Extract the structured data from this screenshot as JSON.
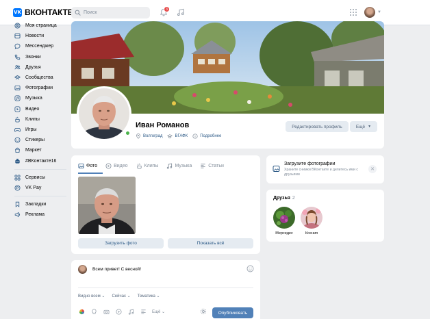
{
  "header": {
    "logo_mark": "VK",
    "logo_text": "ВКОНТАКТЕ",
    "search_placeholder": "Поиск",
    "notifications_count": "3"
  },
  "sidebar": {
    "items": [
      {
        "label": "Моя страница",
        "icon": "user-circle-icon"
      },
      {
        "label": "Новости",
        "icon": "news-icon"
      },
      {
        "label": "Мессенджер",
        "icon": "message-icon"
      },
      {
        "label": "Звонки",
        "icon": "phone-icon"
      },
      {
        "label": "Друзья",
        "icon": "friends-icon"
      },
      {
        "label": "Сообщества",
        "icon": "communities-icon"
      },
      {
        "label": "Фотографии",
        "icon": "photo-icon"
      },
      {
        "label": "Музыка",
        "icon": "music-icon"
      },
      {
        "label": "Видео",
        "icon": "video-icon"
      },
      {
        "label": "Клипы",
        "icon": "clips-icon"
      },
      {
        "label": "Игры",
        "icon": "gamepad-icon"
      },
      {
        "label": "Стикеры",
        "icon": "sticker-icon"
      },
      {
        "label": "Маркет",
        "icon": "market-icon"
      },
      {
        "label": "#ВКонтакте16",
        "icon": "cake-icon"
      }
    ],
    "items2": [
      {
        "label": "Сервисы",
        "icon": "services-icon"
      },
      {
        "label": "VK Pay",
        "icon": "vkpay-icon"
      }
    ],
    "items3": [
      {
        "label": "Закладки",
        "icon": "bookmark-icon"
      },
      {
        "label": "Реклама",
        "icon": "ads-icon"
      }
    ]
  },
  "profile": {
    "name": "Иван Романов",
    "city": "Волгоград",
    "university": "ВГАФК",
    "details": "Подробнее",
    "edit_button": "Редактировать профиль",
    "more_button": "Ещё",
    "online": true
  },
  "photos": {
    "tabs": [
      {
        "label": "Фото",
        "icon": "photo-icon",
        "active": true
      },
      {
        "label": "Видео",
        "icon": "video-icon",
        "active": false
      },
      {
        "label": "Клипы",
        "icon": "clips-icon",
        "active": false
      },
      {
        "label": "Музыка",
        "icon": "music-icon",
        "active": false
      },
      {
        "label": "Статьи",
        "icon": "article-icon",
        "active": false
      }
    ],
    "upload_button": "Загрузить фото",
    "show_all_button": "Показать всё"
  },
  "composer": {
    "text": "Всем привет! С весной!",
    "options": [
      "Видно всем ⌄",
      "Сейчас ⌄",
      "Тематика ⌄"
    ],
    "more_label": "Ещё ⌄",
    "publish_button": "Опубликовать"
  },
  "upload_prompt": {
    "title": "Загрузите фотографии",
    "subtitle": "Храните снимки ВКонтакте и делитесь ими с друзьями"
  },
  "friends": {
    "title": "Друзья",
    "count": "2",
    "list": [
      {
        "name": "Мерседес"
      },
      {
        "name": "Ксения"
      }
    ]
  },
  "colors": {
    "accent": "#0077ff",
    "link": "#2a5885",
    "button_primary": "#5181b8",
    "button_secondary": "#e5ebf1",
    "background": "#edeef0",
    "online": "#4bb34b",
    "badge": "#e64646"
  }
}
